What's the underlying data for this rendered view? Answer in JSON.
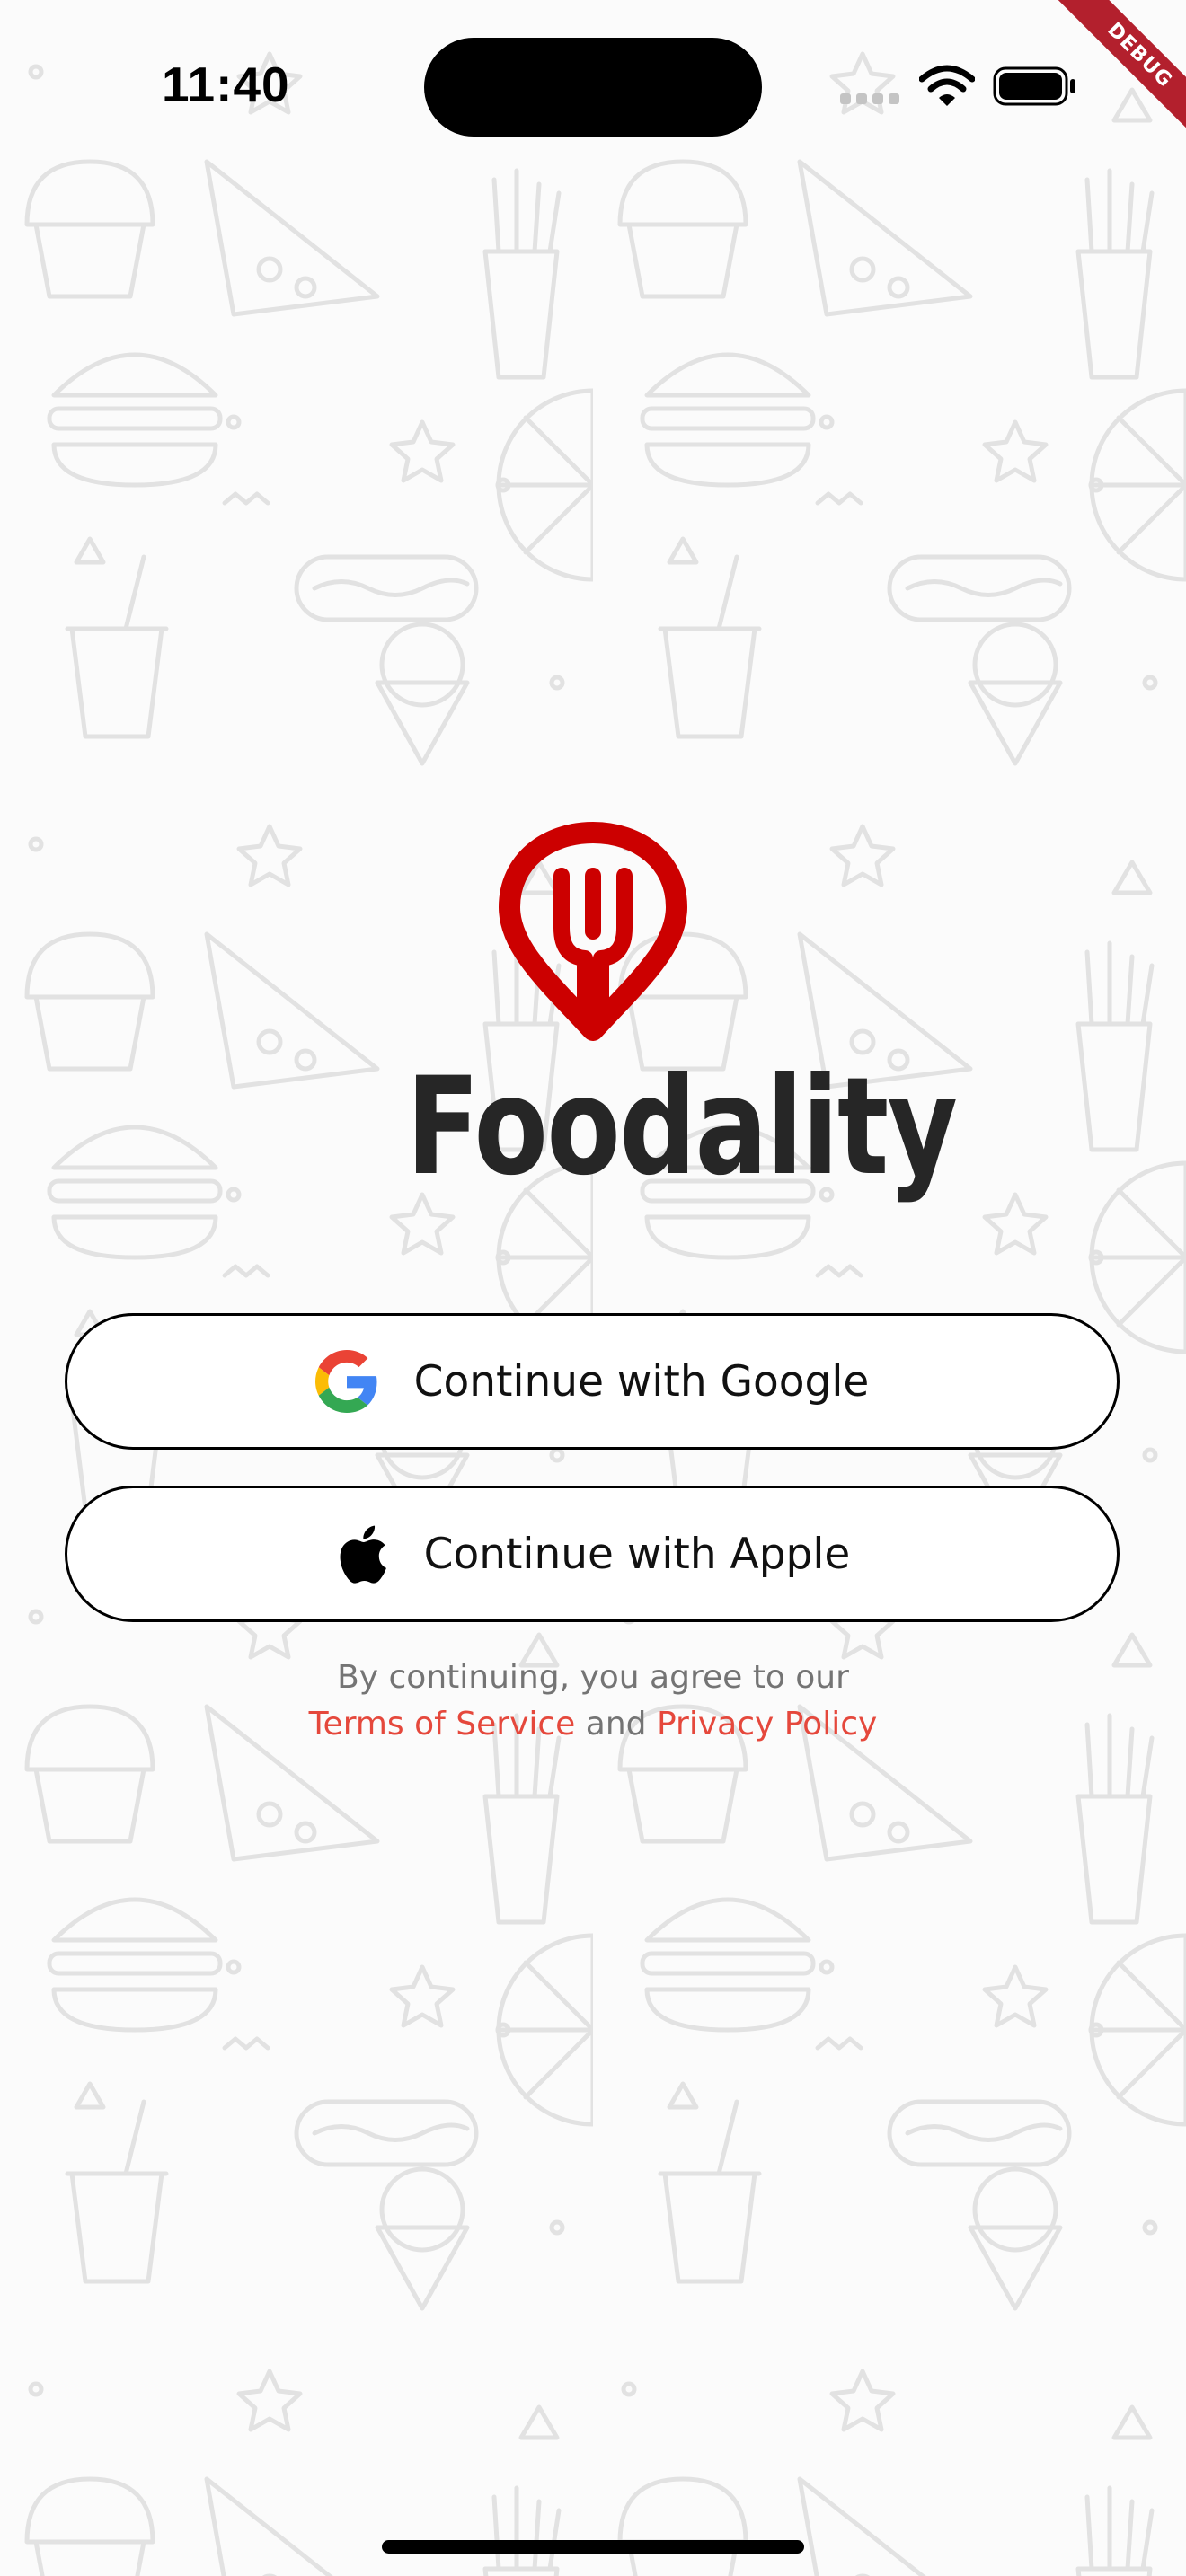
{
  "status_bar": {
    "time": "11:40"
  },
  "debug_banner": {
    "label": "DEBUG"
  },
  "brand": {
    "name": "Foodality",
    "logo_icon": "fork-pin-icon",
    "color": "#cc0000"
  },
  "auth": {
    "google_label": "Continue with Google",
    "google_icon": "google-icon",
    "apple_label": "Continue with Apple",
    "apple_icon": "apple-icon"
  },
  "legal": {
    "prefix": "By continuing, you agree to our",
    "terms_label": "Terms of Service",
    "and": "and",
    "privacy_label": "Privacy Policy",
    "link_color": "#e5483c"
  },
  "background": {
    "pattern": "food-doodle-pattern"
  }
}
